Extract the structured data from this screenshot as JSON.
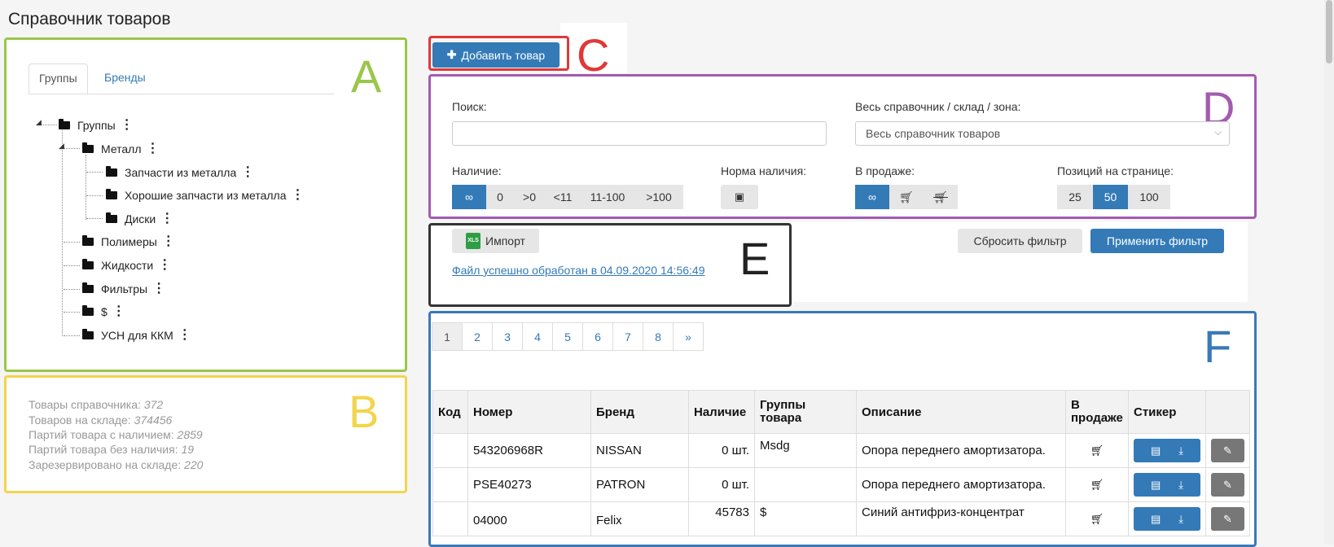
{
  "page": {
    "title": "Справочник товаров"
  },
  "letters": {
    "a": "A",
    "b": "B",
    "c": "C",
    "d": "D",
    "e": "E",
    "f": "F"
  },
  "colors": {
    "a": "#9ac64a",
    "b": "#f2d54b",
    "c": "#e03838",
    "d": "#a35bb0",
    "e": "#333333",
    "f": "#3a79b8",
    "primary": "#337ab7"
  },
  "tabs": {
    "groups": "Группы",
    "brands": "Бренды"
  },
  "tree": {
    "root": "Группы",
    "metal": "Металл",
    "metal_parts": "Запчасти из металла",
    "good_metal_parts": "Хорошие запчасти из металла",
    "disks": "Диски",
    "polymers": "Полимеры",
    "liquids": "Жидкости",
    "filters": "Фильтры",
    "dollar": "$",
    "usn": "УСН для ККМ"
  },
  "stats": [
    {
      "label": "Товары справочника:",
      "value": "372"
    },
    {
      "label": "Товаров на складе:",
      "value": "374456"
    },
    {
      "label": "Партий товара с наличием:",
      "value": "2859"
    },
    {
      "label": "Партий товара без наличия:",
      "value": "19"
    },
    {
      "label": "Зарезервировано на складе:",
      "value": "220"
    }
  ],
  "add_button": {
    "label": "Добавить товар",
    "icon": "plus-icon"
  },
  "filters": {
    "search_label": "Поиск:",
    "search_value": "",
    "scope_label": "Весь справочник / склад / зона:",
    "scope_value": "Весь справочник товаров",
    "stock_label": "Наличие:",
    "stock_options": [
      "∞",
      "0",
      ">0",
      "<11",
      "11-100",
      ">100"
    ],
    "stock_selected": "∞",
    "norm_label": "Норма наличия:",
    "sale_label": "В продаже:",
    "sale_options": [
      "∞",
      "cart-icon",
      "cart-off-icon"
    ],
    "sale_selected": "∞",
    "per_page_label": "Позиций на странице:",
    "per_page_options": [
      "25",
      "50",
      "100"
    ],
    "per_page_selected": "50",
    "reset_label": "Сбросить фильтр",
    "apply_label": "Применить фильтр"
  },
  "import": {
    "button_label": "Импорт",
    "icon": "xls-icon",
    "status_link": "Файл успешно обработан в 04.09.2020 14:56:49"
  },
  "pagination": {
    "pages": [
      "1",
      "2",
      "3",
      "4",
      "5",
      "6",
      "7",
      "8",
      "»"
    ],
    "current": "1"
  },
  "table": {
    "headers": [
      "Код",
      "Номер",
      "Бренд",
      "Наличие",
      "Группы товара",
      "Описание",
      "В продаже",
      "Стикер",
      ""
    ],
    "header_groups_1": "Группы",
    "header_groups_2": "товара",
    "header_sale_1": "В",
    "header_sale_2": "продаже",
    "rows": [
      {
        "code": "",
        "number": "543206968R",
        "brand": "NISSAN",
        "stock": "0 шт.",
        "groups": "Msdg",
        "description": "Опора переднего амортизатора."
      },
      {
        "code": "",
        "number": "PSE40273",
        "brand": "PATRON",
        "stock": "0 шт.",
        "groups": "",
        "description": "Опора переднего амортизатора."
      },
      {
        "code": "",
        "number": "04000",
        "brand": "Felix",
        "stock": "45783",
        "groups": "$",
        "description": "Синий антифриз-концентрат"
      }
    ]
  }
}
